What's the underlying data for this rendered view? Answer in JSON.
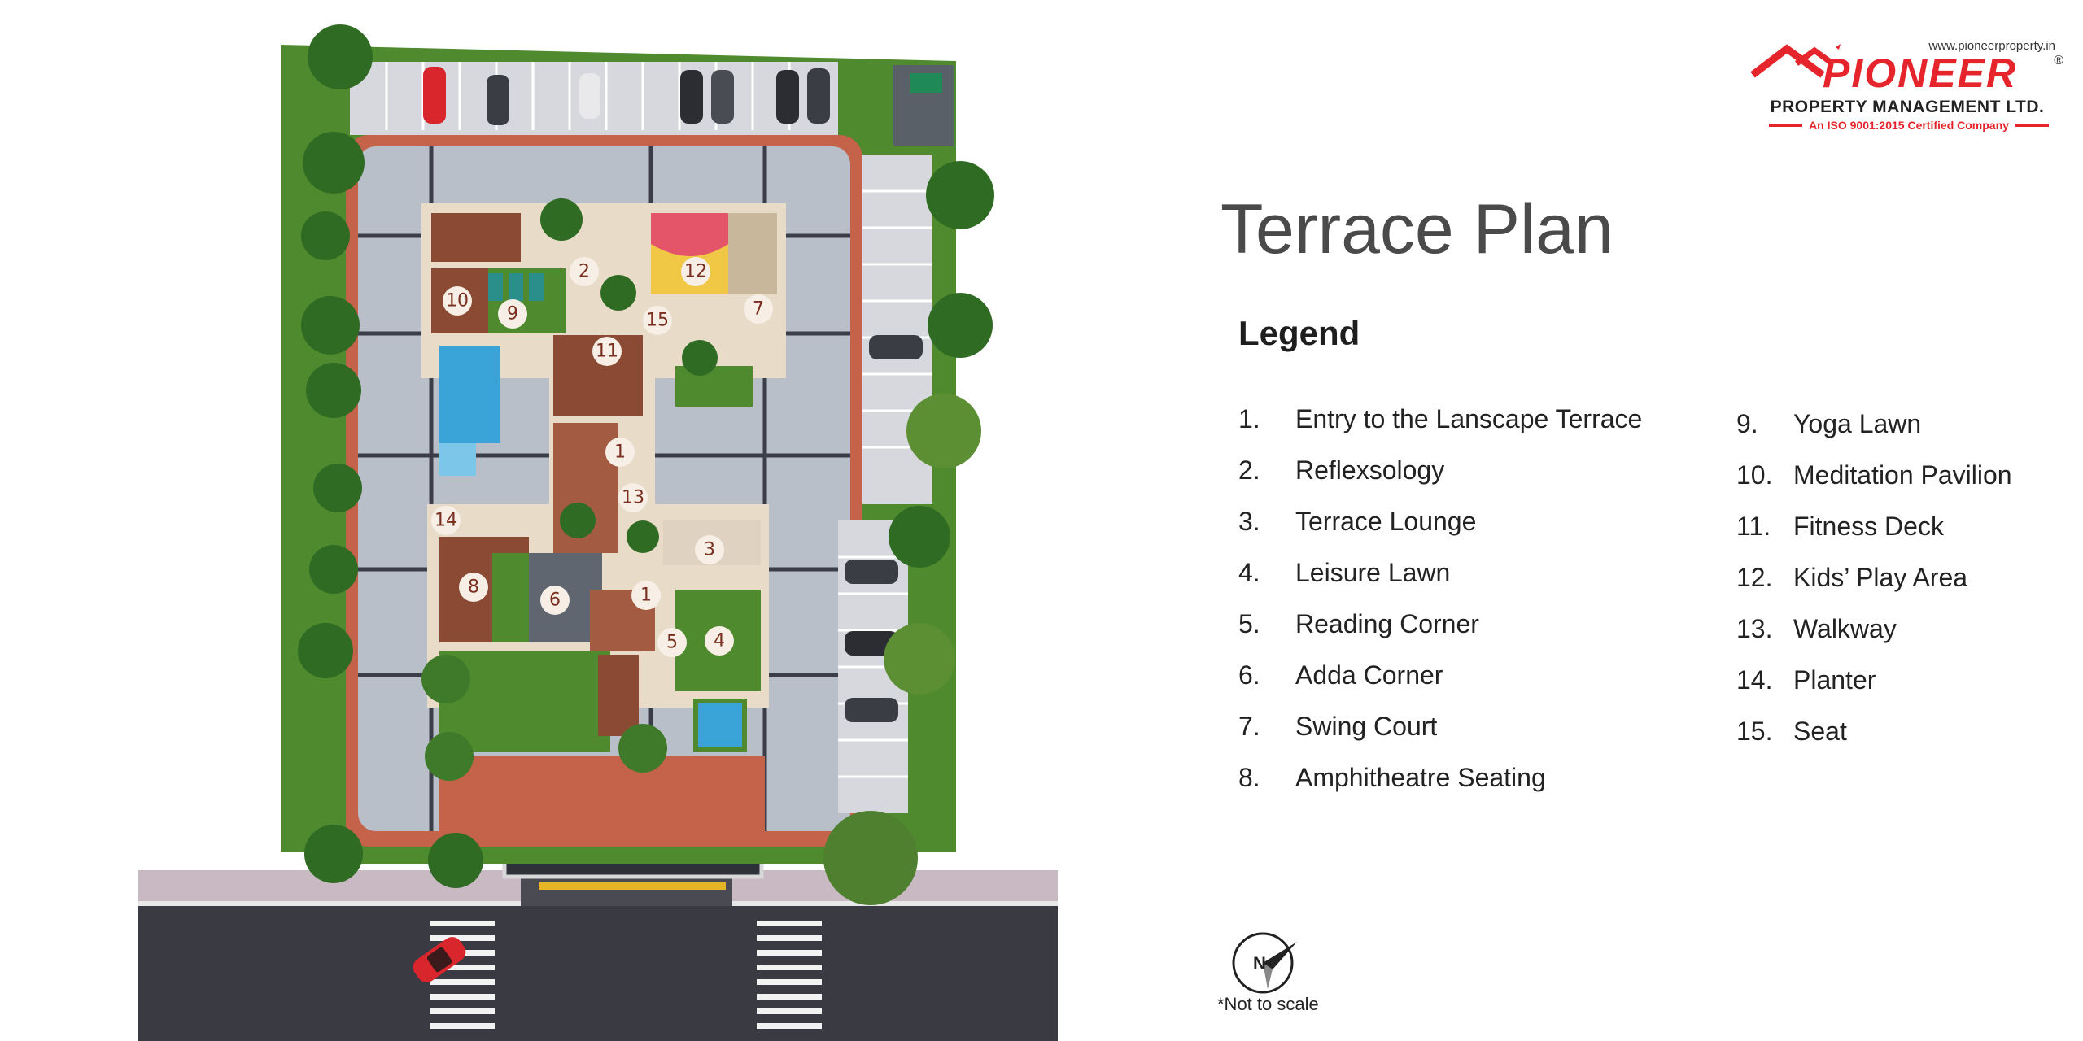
{
  "logo": {
    "url": "www.pioneerproperty.in",
    "name": "PIONEER",
    "registered": "®",
    "subtitle": "PROPERTY MANAGEMENT LTD.",
    "certification": "An ISO 9001:2015 Certified Company",
    "icon": "house-roof-icon",
    "color": "#e5242b"
  },
  "title": "Terrace Plan",
  "legend": {
    "heading": "Legend",
    "items": [
      {
        "num": "1.",
        "label": "Entry to the Lanscape Terrace"
      },
      {
        "num": "2.",
        "label": "Reflexsology"
      },
      {
        "num": "3.",
        "label": "Terrace Lounge"
      },
      {
        "num": "4.",
        "label": "Leisure Lawn"
      },
      {
        "num": "5.",
        "label": "Reading Corner"
      },
      {
        "num": "6.",
        "label": "Adda Corner"
      },
      {
        "num": "7.",
        "label": "Swing Court"
      },
      {
        "num": "8.",
        "label": "Amphitheatre Seating"
      },
      {
        "num": "9.",
        "label": "Yoga Lawn"
      },
      {
        "num": "10.",
        "label": "Meditation Pavilion"
      },
      {
        "num": "11.",
        "label": "Fitness Deck"
      },
      {
        "num": "12.",
        "label": "Kids’ Play Area"
      },
      {
        "num": "13.",
        "label": "Walkway"
      },
      {
        "num": "14.",
        "label": "Planter"
      },
      {
        "num": "15.",
        "label": "Seat"
      }
    ]
  },
  "plan_markers": [
    "1",
    "1",
    "1",
    "2",
    "3",
    "4",
    "5",
    "6",
    "7",
    "8",
    "9",
    "10",
    "11",
    "12",
    "13",
    "14",
    "15"
  ],
  "compass": {
    "letter": "N",
    "icon": "north-compass-icon"
  },
  "scale_note": "*Not to scale",
  "colors": {
    "lawn": "#4f8a2e",
    "deck": "#8a4a34",
    "paving": "#b9bfc8",
    "brick_border": "#c4634a",
    "pool": "#3aa3d8",
    "road": "#3a3b42",
    "marker_fill": "#f7efe6",
    "marker_text": "#7a2e1e"
  }
}
